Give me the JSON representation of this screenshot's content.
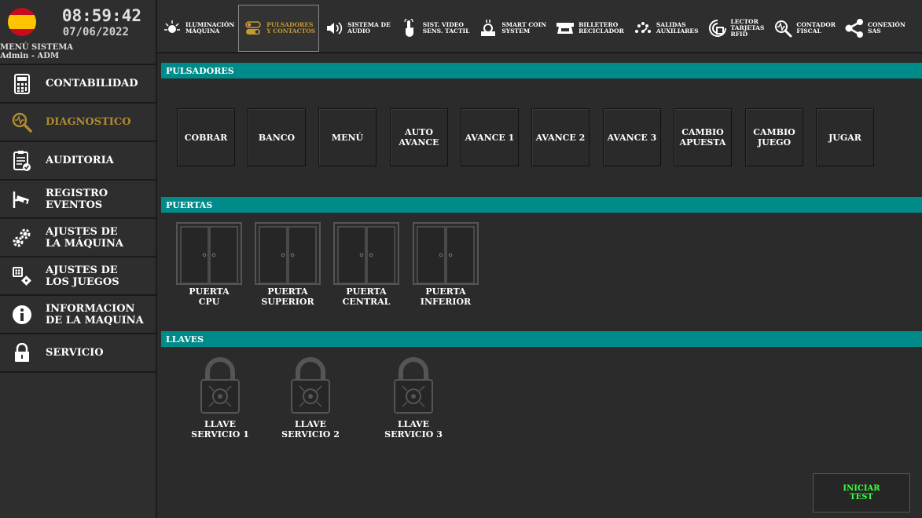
{
  "header": {
    "time": "08:59:42",
    "date": "07/06/2022",
    "menu_title": "MENÚ SISTEMA",
    "user": "Admin - ADM"
  },
  "sidebar": {
    "items": [
      {
        "label": "CONTABILIDAD",
        "icon": "calculator-icon"
      },
      {
        "label": "DIAGNOSTICO",
        "icon": "diagnostic-magnifier-icon",
        "active": true
      },
      {
        "label": "AUDITORIA",
        "icon": "clipboard-check-icon"
      },
      {
        "label": "REGISTRO\nEVENTOS",
        "icon": "camera-icon"
      },
      {
        "label": "AJUSTES DE\nLA MÁQUINA",
        "icon": "gears-icon"
      },
      {
        "label": "AJUSTES DE\nLOS JUEGOS",
        "icon": "game-settings-icon"
      },
      {
        "label": "INFORMACION\nDE LA MAQUINA",
        "icon": "info-icon"
      },
      {
        "label": "SERVICIO",
        "icon": "padlock-icon"
      }
    ]
  },
  "topbar": {
    "items": [
      {
        "label": "ILUMINACIÓN\nMÁQUINA",
        "icon": "light-icon"
      },
      {
        "label": "PULSADORES\nY CONTACTOS",
        "icon": "toggle-icon",
        "active": true
      },
      {
        "label": "SISTEMA DE\nAUDIO",
        "icon": "speaker-icon"
      },
      {
        "label": "SIST. VIDEO\nSENS. TACTIL",
        "icon": "touch-icon"
      },
      {
        "label": "SMART COIN\nSYSTEM",
        "icon": "coin-icon"
      },
      {
        "label": "BILLETERO\nRECICLADOR",
        "icon": "bill-icon"
      },
      {
        "label": "SALIDAS\nAUXILIARES",
        "icon": "outputs-icon"
      },
      {
        "label": "LECTOR\nTARJETAS\nRFID",
        "icon": "rfid-icon"
      },
      {
        "label": "CONTADOR\nFISCAL",
        "icon": "counter-icon"
      },
      {
        "label": "CONEXIÓN\nSAS",
        "icon": "share-icon"
      }
    ]
  },
  "sections": {
    "buttons_title": "PULSADORES",
    "doors_title": "PUERTAS",
    "keys_title": "LLAVES"
  },
  "buttons": [
    "COBRAR",
    "BANCO",
    "MENÚ",
    "AUTO\nAVANCE",
    "AVANCE 1",
    "AVANCE 2",
    "AVANCE 3",
    "CAMBIO\nAPUESTA",
    "CAMBIO\nJUEGO",
    "JUGAR"
  ],
  "doors": [
    "PUERTA\nCPU",
    "PUERTA\nSUPERIOR",
    "PUERTA\nCENTRAL",
    "PUERTA\nINFERIOR"
  ],
  "keys": [
    "LLAVE\nSERVICIO 1",
    "LLAVE\nSERVICIO 2",
    "LLAVE\nSERVICIO 3"
  ],
  "actions": {
    "start_test": "INICIAR\nTEST"
  },
  "colors": {
    "section_header": "#008b8b",
    "active_text": "#c79a30",
    "start_test_text": "#3cff3c"
  }
}
